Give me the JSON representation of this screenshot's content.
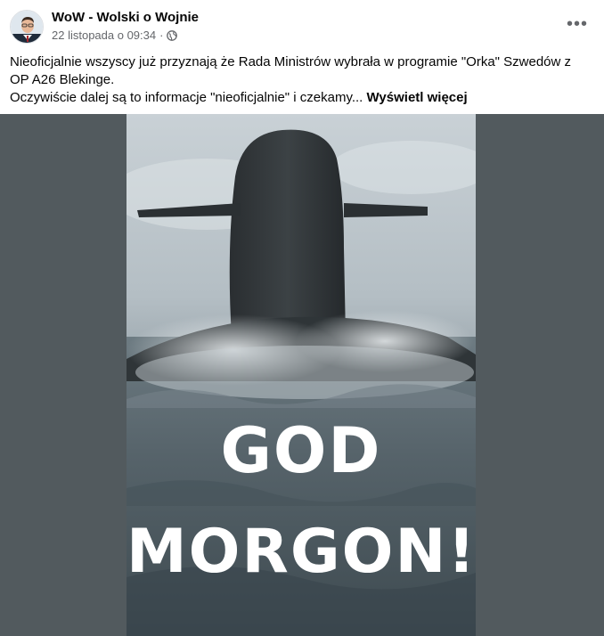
{
  "post": {
    "author": "WoW - Wolski o Wojnie",
    "date": "22 listopada o 09:34",
    "separator": "·",
    "privacy_icon": "globe-icon",
    "more_icon": "more-options-icon",
    "text_line1": "Nieoficjalnie wszyscy już przyznają że Rada Ministrów wybrała w programie \"Orka\" Szwedów z OP A26  Blekinge.",
    "text_line2": "Oczywiście dalej są to informacje \"nieoficjalnie\" i czekamy...",
    "see_more": "Wyświetl więcej"
  },
  "image": {
    "line1": "GOD",
    "line2": "MORGON!",
    "background_color": "#525a5e",
    "text_color": "#ffffff"
  }
}
